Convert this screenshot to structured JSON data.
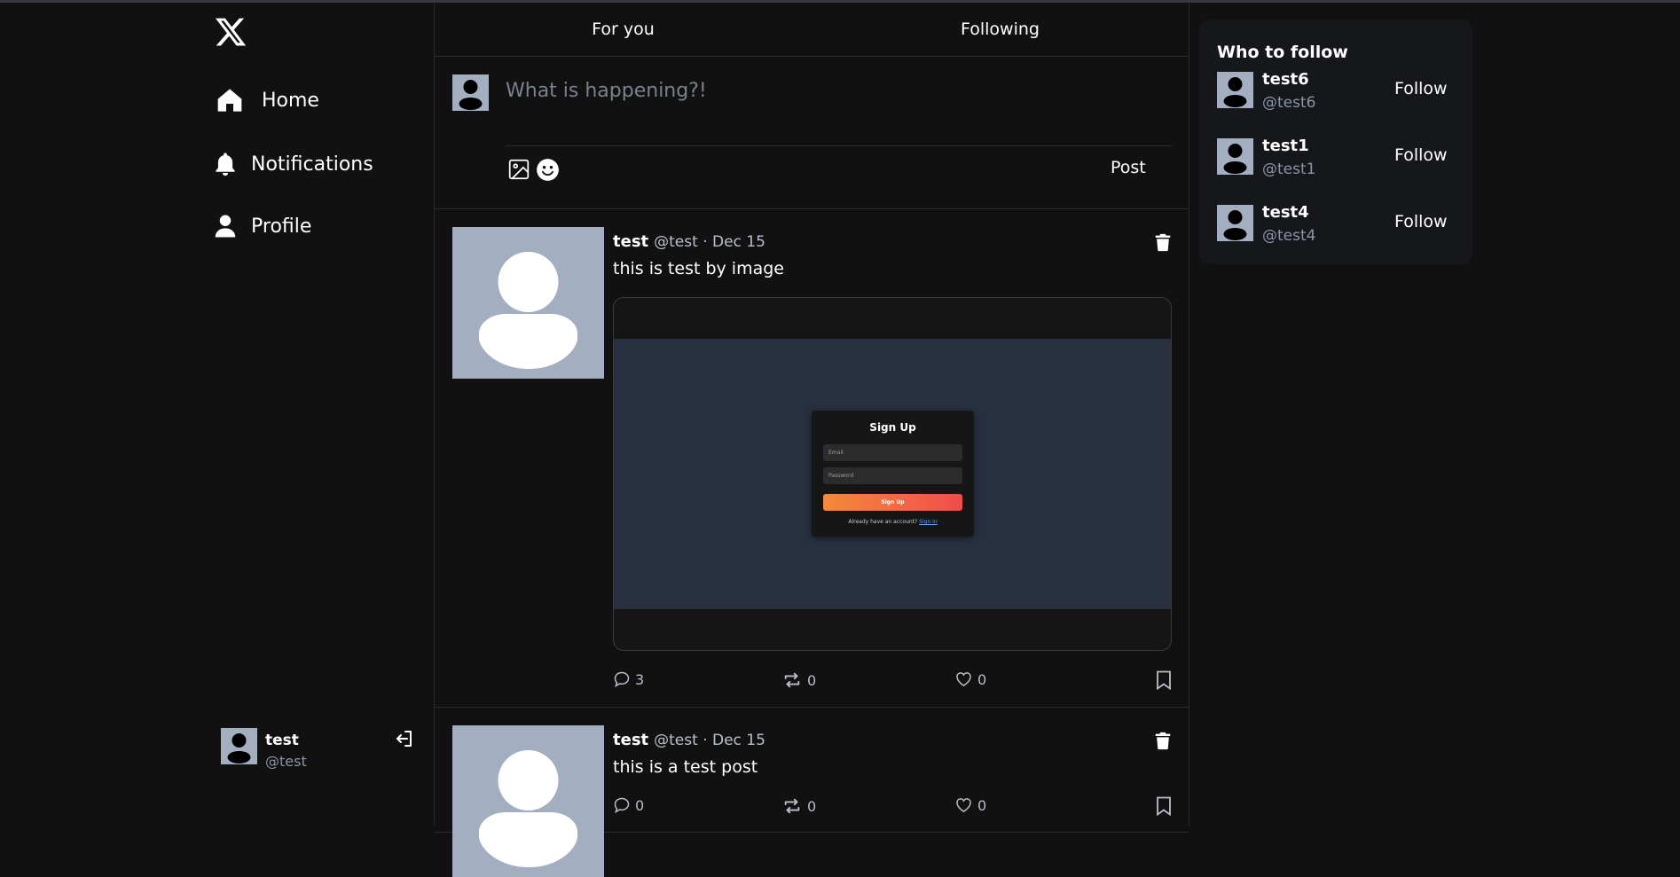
{
  "sidebar": {
    "logo_icon": "x-logo-icon",
    "nav": [
      {
        "label": "Home",
        "icon": "home-icon"
      },
      {
        "label": "Notifications",
        "icon": "bell-icon"
      },
      {
        "label": "Profile",
        "icon": "user-icon"
      }
    ],
    "current_user": {
      "name": "test",
      "handle": "@test",
      "logout_icon": "logout-icon"
    }
  },
  "tabs": [
    {
      "label": "For you"
    },
    {
      "label": "Following"
    }
  ],
  "compose": {
    "placeholder": "What is happening?!",
    "post_label": "Post",
    "icons": [
      "image-icon",
      "emoji-icon"
    ]
  },
  "posts": [
    {
      "name": "test",
      "meta": "@test · Dec 15",
      "text": "this is test by image",
      "media": {
        "title": "Sign Up",
        "email_placeholder": "Email",
        "password_placeholder": "Password",
        "button": "Sign Up",
        "footer": "Already have an account?",
        "footer_link": "Sign in"
      },
      "replies": "3",
      "reposts": "0",
      "likes": "0"
    },
    {
      "name": "test",
      "meta": "@test · Dec 15",
      "text": "this is a test post",
      "replies": "0",
      "reposts": "0",
      "likes": "0"
    }
  ],
  "who_to_follow": {
    "title": "Who to follow",
    "users": [
      {
        "name": "test6",
        "handle": "@test6",
        "button": "Follow"
      },
      {
        "name": "test1",
        "handle": "@test1",
        "button": "Follow"
      },
      {
        "name": "test4",
        "handle": "@test4",
        "button": "Follow"
      }
    ]
  },
  "colors": {
    "background": "#111111",
    "card": "#16171a",
    "avatar": "#a3aec0",
    "muted": "#8b95a6",
    "signup_gradient_start": "#f58b3a",
    "signup_gradient_end": "#ef4c4c"
  }
}
